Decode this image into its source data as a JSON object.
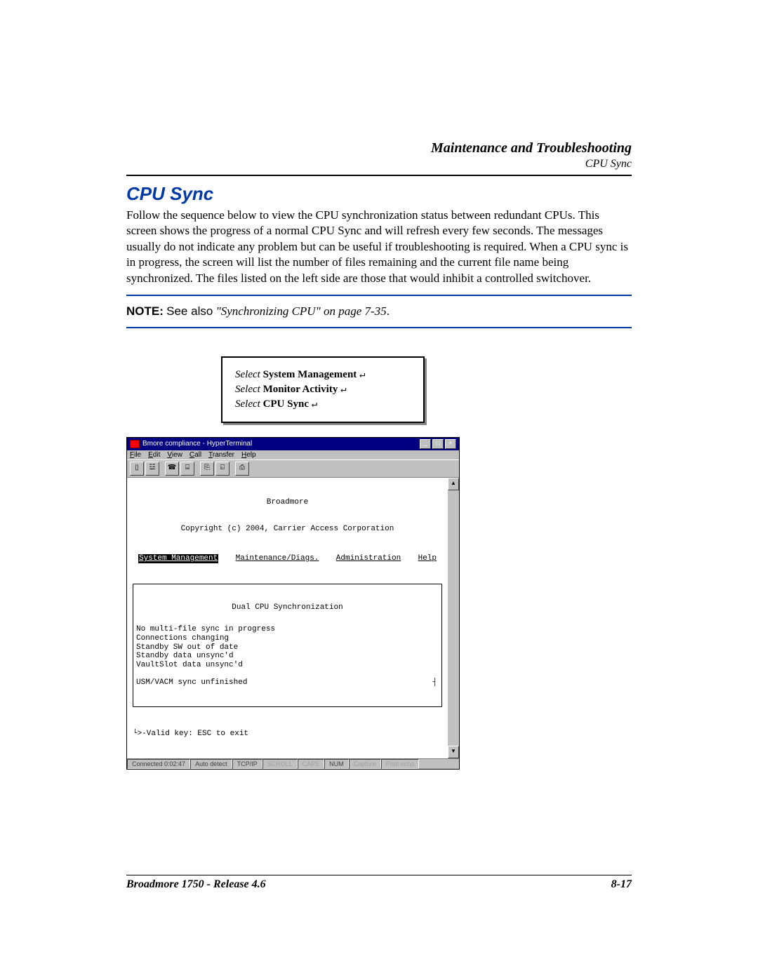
{
  "header": {
    "chapter": "Maintenance and Troubleshooting",
    "section": "CPU Sync"
  },
  "heading": "CPU Sync",
  "body": "Follow the sequence below to view the CPU synchronization status between redundant CPUs. This screen shows the progress of a normal CPU Sync and will refresh every few seconds. The messages usually do not indicate any problem but can be useful if troubleshooting is required. When a CPU sync is in progress, the screen will list the number of files remaining and the current file name being synchronized. The files listed on the left side are those that would inhibit a controlled switchover.",
  "note": {
    "label": "NOTE:",
    "see_also": "See also",
    "ref": "\"Synchronizing CPU\" on page 7-35",
    "period": "."
  },
  "steps": {
    "select_word": "Select",
    "items": [
      "System Management",
      "Monitor Activity",
      "CPU Sync"
    ],
    "return_glyph": "↵"
  },
  "ht": {
    "title": "Bmore compliance - HyperTerminal",
    "menubar": [
      "File",
      "Edit",
      "View",
      "Call",
      "Transfer",
      "Help"
    ],
    "toolbar_glyphs": [
      "▯",
      "☳",
      "",
      "☎",
      "⌸",
      "",
      "⎘",
      "⍇",
      "",
      "⎙"
    ],
    "banner_line1": "Broadmore",
    "banner_line2": "Copyright (c) 2004, Carrier Access Corporation",
    "menu_items": [
      "System Management",
      "Maintenance/Diags.",
      "Administration",
      "Help"
    ],
    "box_title": "Dual CPU Synchronization",
    "box_lines": [
      "No multi-file sync in progress",
      "Connections changing",
      "Standby SW out of date",
      "Standby data unsync'd",
      "VaultSlot data unsync'd",
      "",
      "USM/VACM sync unfinished"
    ],
    "footer_hint": "└>-Valid key: ESC to exit",
    "scroll_up": "▲",
    "scroll_down": "▼",
    "status": {
      "connected": "Connected 0:02:47",
      "detect": "Auto detect",
      "proto": "TCP/IP",
      "scroll": "SCROLL",
      "caps": "CAPS",
      "num": "NUM",
      "capture": "Capture",
      "echo": "Print echo"
    },
    "win_min": "_",
    "win_max": "□",
    "win_close": "×"
  },
  "footer": {
    "left": "Broadmore 1750 - Release 4.6",
    "right": "8-17"
  }
}
